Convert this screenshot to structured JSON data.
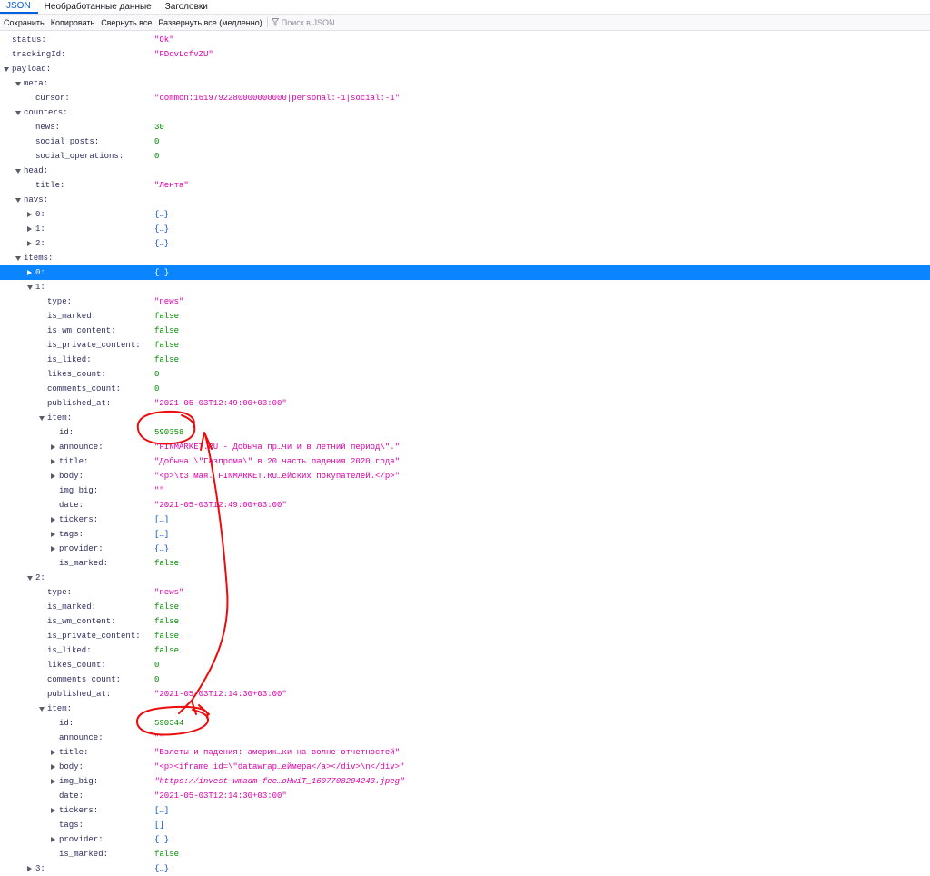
{
  "tabs": [
    {
      "label": "JSON"
    },
    {
      "label": "Необработанные данные"
    },
    {
      "label": "Заголовки"
    }
  ],
  "toolbar": {
    "save": "Сохранить",
    "copy": "Копировать",
    "collapse_all": "Свернуть все",
    "expand_all": "Развернуть все (медленно)",
    "filter_placeholder": "Поиск в JSON"
  },
  "rows": [
    {
      "depth": 0,
      "t": "none",
      "key": "status:",
      "val": "\"Ok\"",
      "type": "string"
    },
    {
      "depth": 0,
      "t": "none",
      "key": "trackingId:",
      "val": "\"FDqvLcfvZU\"",
      "type": "string"
    },
    {
      "depth": 0,
      "t": "open",
      "key": "payload:",
      "val": "",
      "type": "none"
    },
    {
      "depth": 1,
      "t": "open",
      "key": "meta:",
      "val": "",
      "type": "none"
    },
    {
      "depth": 2,
      "t": "none",
      "key": "cursor:",
      "val": "\"common:1619792280000000000|personal:-1|social:-1\"",
      "type": "string"
    },
    {
      "depth": 1,
      "t": "open",
      "key": "counters:",
      "val": "",
      "type": "none"
    },
    {
      "depth": 2,
      "t": "none",
      "key": "news:",
      "val": "30",
      "type": "number"
    },
    {
      "depth": 2,
      "t": "none",
      "key": "social_posts:",
      "val": "0",
      "type": "number"
    },
    {
      "depth": 2,
      "t": "none",
      "key": "social_operations:",
      "val": "0",
      "type": "number"
    },
    {
      "depth": 1,
      "t": "open",
      "key": "head:",
      "val": "",
      "type": "none"
    },
    {
      "depth": 2,
      "t": "none",
      "key": "title:",
      "val": "\"Лента\"",
      "type": "string"
    },
    {
      "depth": 1,
      "t": "open",
      "key": "navs:",
      "val": "",
      "type": "none"
    },
    {
      "depth": 2,
      "t": "closed",
      "key": "0:",
      "val": "{…}",
      "type": "object"
    },
    {
      "depth": 2,
      "t": "closed",
      "key": "1:",
      "val": "{…}",
      "type": "object"
    },
    {
      "depth": 2,
      "t": "closed",
      "key": "2:",
      "val": "{…}",
      "type": "object"
    },
    {
      "depth": 1,
      "t": "open",
      "key": "items:",
      "val": "",
      "type": "none"
    },
    {
      "depth": 2,
      "t": "closed",
      "key": "0:",
      "val": "{…}",
      "type": "object",
      "selected": true
    },
    {
      "depth": 2,
      "t": "open",
      "key": "1:",
      "val": "",
      "type": "none"
    },
    {
      "depth": 3,
      "t": "none",
      "key": "type:",
      "val": "\"news\"",
      "type": "string"
    },
    {
      "depth": 3,
      "t": "none",
      "key": "is_marked:",
      "val": "false",
      "type": "boolean"
    },
    {
      "depth": 3,
      "t": "none",
      "key": "is_wm_content:",
      "val": "false",
      "type": "boolean"
    },
    {
      "depth": 3,
      "t": "none",
      "key": "is_private_content:",
      "val": "false",
      "type": "boolean"
    },
    {
      "depth": 3,
      "t": "none",
      "key": "is_liked:",
      "val": "false",
      "type": "boolean"
    },
    {
      "depth": 3,
      "t": "none",
      "key": "likes_count:",
      "val": "0",
      "type": "number"
    },
    {
      "depth": 3,
      "t": "none",
      "key": "comments_count:",
      "val": "0",
      "type": "number"
    },
    {
      "depth": 3,
      "t": "none",
      "key": "published_at:",
      "val": "\"2021-05-03T12:49:00+03:00\"",
      "type": "string"
    },
    {
      "depth": 3,
      "t": "open",
      "key": "item:",
      "val": "",
      "type": "none"
    },
    {
      "depth": 4,
      "t": "none",
      "key": "id:",
      "val": "590358",
      "type": "number"
    },
    {
      "depth": 4,
      "t": "closed",
      "key": "announce:",
      "val": "\"FINMARKET.RU - Добыча пр…чи и в летний период\\\".\"",
      "type": "string"
    },
    {
      "depth": 4,
      "t": "closed",
      "key": "title:",
      "val": "\"Добыча \\\"Газпрома\\\" в 20…часть падения 2020 года\"",
      "type": "string"
    },
    {
      "depth": 4,
      "t": "closed",
      "key": "body:",
      "val": "\"<p>\\t3 мая. FINMARKET.RU…ейских покупателей.</p>\"",
      "type": "string"
    },
    {
      "depth": 4,
      "t": "none",
      "key": "img_big:",
      "val": "\"\"",
      "type": "string"
    },
    {
      "depth": 4,
      "t": "none",
      "key": "date:",
      "val": "\"2021-05-03T12:49:00+03:00\"",
      "type": "string"
    },
    {
      "depth": 4,
      "t": "closed",
      "key": "tickers:",
      "val": "[…]",
      "type": "object"
    },
    {
      "depth": 4,
      "t": "closed",
      "key": "tags:",
      "val": "[…]",
      "type": "object"
    },
    {
      "depth": 4,
      "t": "closed",
      "key": "provider:",
      "val": "{…}",
      "type": "object"
    },
    {
      "depth": 4,
      "t": "none",
      "key": "is_marked:",
      "val": "false",
      "type": "boolean"
    },
    {
      "depth": 2,
      "t": "open",
      "key": "2:",
      "val": "",
      "type": "none"
    },
    {
      "depth": 3,
      "t": "none",
      "key": "type:",
      "val": "\"news\"",
      "type": "string"
    },
    {
      "depth": 3,
      "t": "none",
      "key": "is_marked:",
      "val": "false",
      "type": "boolean"
    },
    {
      "depth": 3,
      "t": "none",
      "key": "is_wm_content:",
      "val": "false",
      "type": "boolean"
    },
    {
      "depth": 3,
      "t": "none",
      "key": "is_private_content:",
      "val": "false",
      "type": "boolean"
    },
    {
      "depth": 3,
      "t": "none",
      "key": "is_liked:",
      "val": "false",
      "type": "boolean"
    },
    {
      "depth": 3,
      "t": "none",
      "key": "likes_count:",
      "val": "0",
      "type": "number"
    },
    {
      "depth": 3,
      "t": "none",
      "key": "comments_count:",
      "val": "0",
      "type": "number"
    },
    {
      "depth": 3,
      "t": "none",
      "key": "published_at:",
      "val": "\"2021-05-03T12:14:30+03:00\"",
      "type": "string"
    },
    {
      "depth": 3,
      "t": "open",
      "key": "item:",
      "val": "",
      "type": "none"
    },
    {
      "depth": 4,
      "t": "none",
      "key": "id:",
      "val": "590344",
      "type": "number"
    },
    {
      "depth": 4,
      "t": "none",
      "key": "announce:",
      "val": "\"\"",
      "type": "string"
    },
    {
      "depth": 4,
      "t": "closed",
      "key": "title:",
      "val": "\"Взлеты и падения: америк…ки на волне отчетностей\"",
      "type": "string"
    },
    {
      "depth": 4,
      "t": "closed",
      "key": "body:",
      "val": "\"<p><iframe id=\\\"datawrap…еймера</a></div>\\n</div>\"",
      "type": "string"
    },
    {
      "depth": 4,
      "t": "closed",
      "key": "img_big:",
      "val": "\"https://invest-wmadm-fee…oHwiT_1607708204243.jpeg\"",
      "type": "url"
    },
    {
      "depth": 4,
      "t": "none",
      "key": "date:",
      "val": "\"2021-05-03T12:14:30+03:00\"",
      "type": "string"
    },
    {
      "depth": 4,
      "t": "closed",
      "key": "tickers:",
      "val": "[…]",
      "type": "object"
    },
    {
      "depth": 4,
      "t": "none",
      "key": "tags:",
      "val": "[]",
      "type": "object"
    },
    {
      "depth": 4,
      "t": "closed",
      "key": "provider:",
      "val": "{…}",
      "type": "object"
    },
    {
      "depth": 4,
      "t": "none",
      "key": "is_marked:",
      "val": "false",
      "type": "boolean"
    },
    {
      "depth": 2,
      "t": "closed",
      "key": "3:",
      "val": "{…}",
      "type": "object"
    }
  ]
}
